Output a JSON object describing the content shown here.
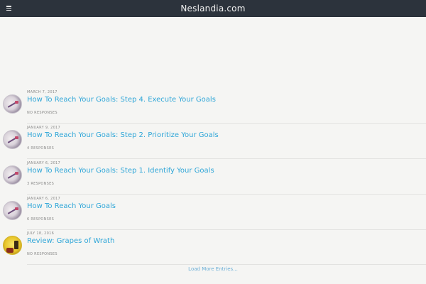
{
  "header": {
    "site_title": "Neslandia.com",
    "menu_icon": "hamburger-menu-icon",
    "background": "#2c333c"
  },
  "entries": [
    {
      "date": "MARCH 7, 2017",
      "title": "How To Reach Your Goals: Step 4. Execute Your Goals",
      "responses": "NO RESPONSES",
      "avatar": "goals-thumbnail-icon"
    },
    {
      "date": "JANUARY 9, 2017",
      "title": "How To Reach Your Goals: Step 2. Prioritize Your Goals",
      "responses": "4 RESPONSES",
      "avatar": "goals-thumbnail-icon"
    },
    {
      "date": "JANUARY 6, 2017",
      "title": "How To Reach Your Goals: Step 1. Identify Your Goals",
      "responses": "3 RESPONSES",
      "avatar": "goals-thumbnail-icon"
    },
    {
      "date": "JANUARY 6, 2017",
      "title": "How To Reach Your Goals",
      "responses": "6 RESPONSES",
      "avatar": "goals-thumbnail-icon"
    },
    {
      "date": "JULY 18, 2016",
      "title": "Review: Grapes of Wrath",
      "responses": "NO RESPONSES",
      "avatar": "book-thumbnail-icon"
    }
  ],
  "load_more_label": "Load More Entries...",
  "colors": {
    "link": "#2fa6d8",
    "meta": "#8a8a8a",
    "page_background": "#f5f5f3"
  }
}
